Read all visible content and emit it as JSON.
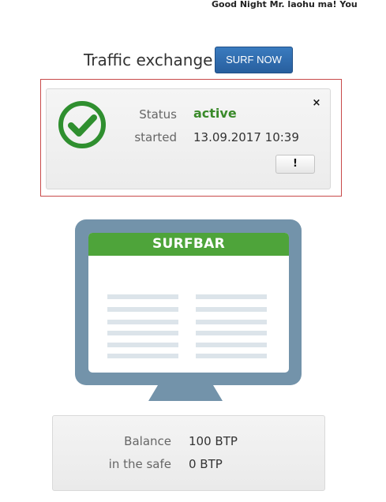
{
  "header": {
    "greeting": "Good Night Mr. laohu ma! You"
  },
  "traffic": {
    "title": "Traffic exchange",
    "surf_button": "SURF NOW"
  },
  "status_box": {
    "status_label": "Status",
    "status_value": "active",
    "started_label": "started",
    "started_value": "13.09.2017 10:39",
    "close_label": "×",
    "info_button": "!",
    "colors": {
      "active": "#3a8a2a",
      "check": "#2f8f2f",
      "frame": "#c84a4a"
    },
    "icons": [
      "check-circle-icon",
      "close-icon"
    ]
  },
  "surfbar": {
    "header": "SURFBAR",
    "colors": {
      "monitor": "#7393aa",
      "header": "#4ea43a",
      "lines": "#dce4ea"
    }
  },
  "balance": {
    "balance_label": "Balance",
    "balance_value": "100 BTP",
    "safe_label": "in the safe",
    "safe_value": "0 BTP"
  }
}
